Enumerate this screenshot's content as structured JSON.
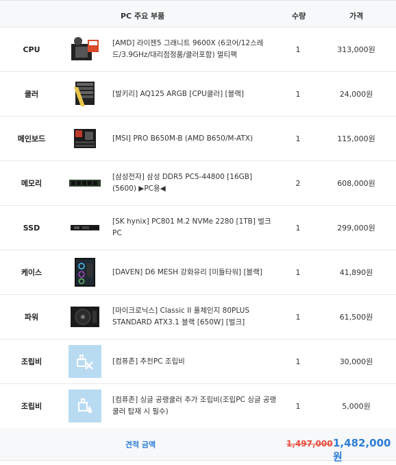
{
  "header": {
    "product": "PC 주요 부품",
    "qty": "수량",
    "price": "가격"
  },
  "rows": [
    {
      "category": "CPU",
      "name": "[AMD] 라이젠5 그래니트 9600X (6코어/12스레드/3.9GHz/대리점정품/쿨러포함) 멀티팩",
      "qty": "1",
      "price": "313,000원",
      "icon": "cpu-box-icon"
    },
    {
      "category": "쿨러",
      "name": "[발키리] AQ125 ARGB [CPU쿨러] [블랙]",
      "qty": "1",
      "price": "24,000원",
      "icon": "cooler-icon"
    },
    {
      "category": "메인보드",
      "name": "[MSI] PRO B650M-B (AMD B650/M-ATX)",
      "qty": "1",
      "price": "115,000원",
      "icon": "motherboard-icon"
    },
    {
      "category": "메모리",
      "name": "[삼성전자] 삼성 DDR5 PC5-44800 [16GB] (5600) ▶PC용◀",
      "qty": "2",
      "price": "608,000원",
      "icon": "memory-icon"
    },
    {
      "category": "SSD",
      "name": "[SK hynix] PC801 M.2 NVMe 2280 [1TB] 벌크 PC",
      "qty": "1",
      "price": "299,000원",
      "icon": "ssd-icon"
    },
    {
      "category": "케이스",
      "name": "[DAVEN] D6 MESH 강화유리 [미들타워] [블랙]",
      "qty": "1",
      "price": "41,890원",
      "icon": "case-icon"
    },
    {
      "category": "파워",
      "name": "[마이크로닉스] Classic II 풀체인지 80PLUS STANDARD ATX3.1 블랙 [650W] [벌크]",
      "qty": "1",
      "price": "61,500원",
      "icon": "psu-icon"
    },
    {
      "category": "조립비",
      "name": "[컴퓨존] 추천PC 조립비",
      "qty": "1",
      "price": "30,000원",
      "icon": "assembly-tools-icon"
    },
    {
      "category": "조립비",
      "name": "[컴퓨존] 싱글 공랭쿨러 추가 조립비(조립PC 싱글 공랭쿨러 탑재 시 필수)",
      "qty": "1",
      "price": "5,000원",
      "icon": "cooler-assembly-icon"
    }
  ],
  "footer": {
    "label": "견적 금액",
    "original": "1,497,000",
    "discounted": "1,482,000원"
  },
  "colors": {
    "accent": "#2b7bd6",
    "strike": "#e74c3c",
    "assembly_bg": "#b9dbf2"
  }
}
